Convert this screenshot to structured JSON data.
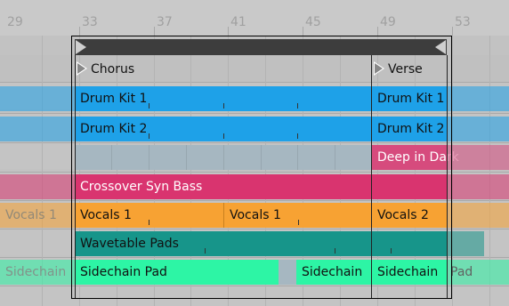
{
  "ruler": {
    "bars": [
      "29",
      "33",
      "37",
      "41",
      "45",
      "49",
      "53"
    ]
  },
  "locators": [
    {
      "label": "Chorus"
    },
    {
      "label": "Verse"
    }
  ],
  "colors": {
    "drum": "#1ea1e8",
    "deep": "#d64b7d",
    "bass": "#d9346f",
    "vocals": "#f7a233",
    "wavetable": "#17958a",
    "sidechain": "#2df5a5",
    "empty_clip": "#a6b7c1"
  },
  "tracks": {
    "drum1": {
      "clips": [
        "Drum Kit 1",
        "Drum Kit 1"
      ]
    },
    "drum2": {
      "clips": [
        "Drum Kit 2",
        "Drum Kit 2"
      ]
    },
    "deep": {
      "clips": [
        "Deep in Dark"
      ]
    },
    "bass": {
      "clips": [
        "Crossover Syn Bass"
      ]
    },
    "vocals": {
      "clips": [
        "Vocals 1",
        "Vocals 1",
        "Vocals 1",
        "Vocals 2"
      ]
    },
    "wavetable": {
      "clips": [
        "Wavetable Pads"
      ]
    },
    "sidechain": {
      "clips": [
        "Sidechain",
        "Sidechain Pad",
        "Sidechain",
        "Sidechain",
        "Pad"
      ]
    }
  }
}
